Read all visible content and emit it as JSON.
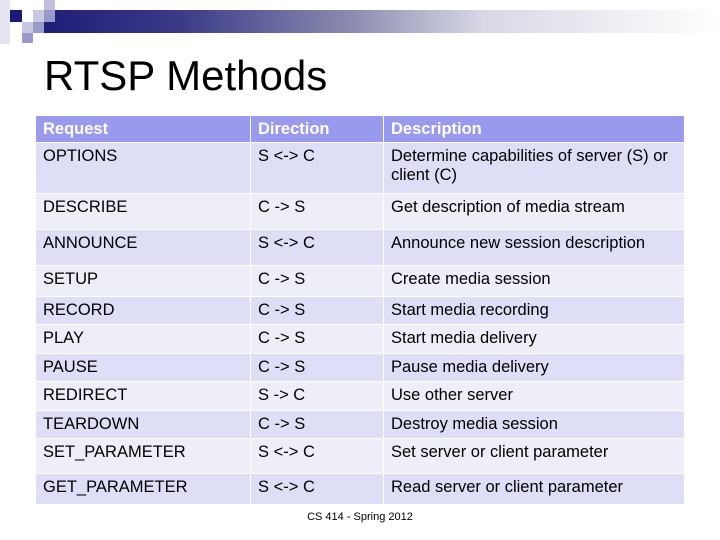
{
  "slide": {
    "title": "RTSP Methods",
    "footer": "CS 414 - Spring 2012",
    "colors": {
      "header_bg": "#9999ee",
      "row_odd_bg": "#dedef6",
      "row_even_bg": "#eeeef9",
      "banner_dark": "#1e1e7a"
    }
  },
  "table": {
    "headers": [
      "Request",
      "Direction",
      "Description"
    ],
    "rows": [
      {
        "request": "OPTIONS",
        "direction": "S <-> C",
        "description": "Determine capabilities of server (S) or client (C)"
      },
      {
        "request": "DESCRIBE",
        "direction": "C ->  S",
        "description": "Get description of media stream"
      },
      {
        "request": "ANNOUNCE",
        "direction": "S <-> C",
        "description": "Announce new session description"
      },
      {
        "request": "SETUP",
        "direction": "C -> S",
        "description": "Create  media session"
      },
      {
        "request": "RECORD",
        "direction": "C -> S",
        "description": "Start media recording"
      },
      {
        "request": "PLAY",
        "direction": "C -> S",
        "description": "Start media delivery"
      },
      {
        "request": "PAUSE",
        "direction": "C -> S",
        "description": "Pause media delivery"
      },
      {
        "request": "REDIRECT",
        "direction": "S -> C",
        "description": "Use other server"
      },
      {
        "request": "TEARDOWN",
        "direction": "C -> S",
        "description": "Destroy media session"
      },
      {
        "request": "SET_PARAMETER",
        "direction": "S <-> C",
        "description": "Set server or client parameter"
      },
      {
        "request": "GET_PARAMETER",
        "direction": "S <-> C",
        "description": "Read server or client parameter"
      }
    ]
  }
}
